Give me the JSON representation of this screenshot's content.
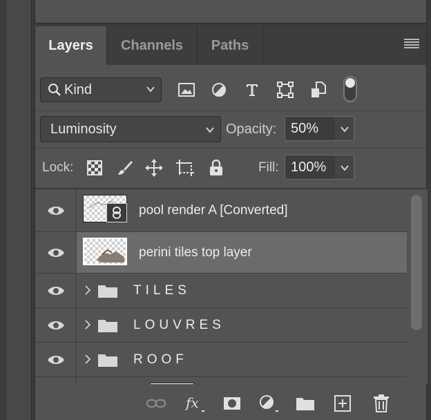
{
  "tabs": [
    {
      "label": "Layers",
      "active": true
    },
    {
      "label": "Channels",
      "active": false
    },
    {
      "label": "Paths",
      "active": false
    }
  ],
  "filter": {
    "kind_label": "Kind",
    "icons": [
      "image-filter-icon",
      "adjustment-filter-icon",
      "type-filter-icon",
      "shape-filter-icon",
      "smart-object-filter-icon"
    ]
  },
  "blend": {
    "mode": "Luminosity",
    "opacity_label": "Opacity:",
    "opacity_value": "50%"
  },
  "lock": {
    "label": "Lock:",
    "fill_label": "Fill:",
    "fill_value": "100%",
    "icons": [
      "lock-transparent-pixels-icon",
      "lock-image-pixels-icon",
      "lock-position-icon",
      "lock-artboard-icon",
      "lock-all-icon"
    ]
  },
  "layers": [
    {
      "name": "pool render A [Converted]",
      "type": "smart-object",
      "visible": true,
      "selected": false
    },
    {
      "name": "perini tiles top layer",
      "type": "pixel",
      "visible": true,
      "selected": true
    },
    {
      "name": "TILES",
      "type": "group",
      "visible": true,
      "selected": false
    },
    {
      "name": "LOUVRES",
      "type": "group",
      "visible": true,
      "selected": false
    },
    {
      "name": "ROOF",
      "type": "group",
      "visible": true,
      "selected": false
    }
  ],
  "footer_icons": [
    "link-layers-icon",
    "fx-icon",
    "layer-mask-icon",
    "adjustment-layer-icon",
    "new-group-icon",
    "new-layer-icon",
    "delete-layer-icon"
  ],
  "colors": {
    "panel": "#535353",
    "tabbar": "#3d3d3d",
    "selected_row": "#6b6b6b",
    "text": "#ececec"
  }
}
